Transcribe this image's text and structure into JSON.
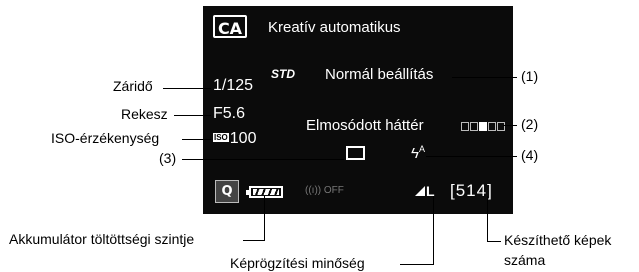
{
  "screen": {
    "mode_badge": "CA",
    "mode_title": "Kreatív automatikus",
    "picture_style_icon": "STD",
    "picture_style": "Normál beállítás",
    "background_blur": "Elmosódott háttér",
    "blur_scale_level": 3,
    "shutter_speed": "1/125",
    "aperture": "F5.6",
    "iso_tag": "ISO",
    "iso_value": "100",
    "flash_auto": "A",
    "quick_button": "Q",
    "wifi_status": "((ı)) OFF",
    "quality_size": "L",
    "shots_remaining": "[514]"
  },
  "callouts": {
    "shutter": "Záridő",
    "aperture": "Rekesz",
    "iso": "ISO-érzékenység",
    "drive_marker": "(3)",
    "style_marker": "(1)",
    "blur_marker": "(2)",
    "flash_marker": "(4)",
    "battery": "Akkumulátor töltöttségi szintje",
    "quality": "Képrögzítési minőség",
    "shots_line1": "Készíthető képek",
    "shots_line2": "száma"
  },
  "icons": [
    "std-picture-style-icon",
    "drive-single-icon",
    "flash-auto-icon",
    "battery-icon",
    "wifi-off-icon",
    "quality-large-icon"
  ],
  "colors": {
    "lcd_background": "#0b0b0b",
    "lcd_text": "#ffffff"
  }
}
